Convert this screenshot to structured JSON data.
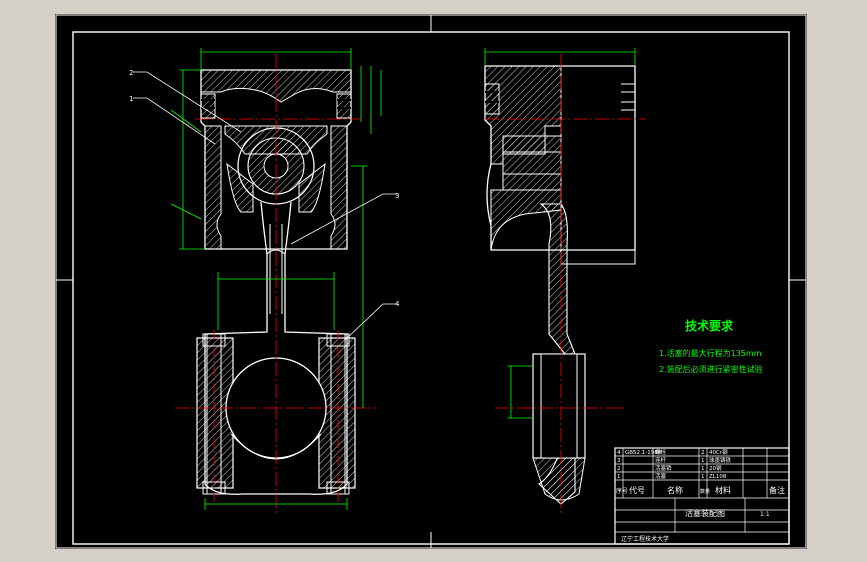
{
  "colors": {
    "background": "#d4d0c8",
    "sheet": "#000000",
    "frame": "#ffffff",
    "dimension": "#00ff00",
    "centerline": "#ff0000",
    "hatch": "#ffffff",
    "note_text": "#00ff00"
  },
  "tech_requirements": {
    "title": "技术要求",
    "items": [
      "1.活塞的最大行程为135mm",
      "2.装配后必须进行紧密性试验"
    ]
  },
  "balloons": [
    "2",
    "1",
    "3",
    "4"
  ],
  "title_block": {
    "parts": [
      {
        "no": "4",
        "code": "GB52.1-1988",
        "name": "螺栓",
        "qty": "2",
        "material": "40Cr钢"
      },
      {
        "no": "3",
        "code": "",
        "name": "连杆",
        "qty": "1",
        "material": "球墨铸铁"
      },
      {
        "no": "2",
        "code": "",
        "name": "活塞销",
        "qty": "1",
        "material": "20钢"
      },
      {
        "no": "1",
        "code": "",
        "name": "活塞",
        "qty": "1",
        "material": "ZL108"
      }
    ],
    "header": {
      "no": "序号",
      "code": "代号",
      "name": "名称",
      "qty": "数量",
      "material": "材料",
      "remark": "备注"
    },
    "drawing_title": "活塞装配图",
    "scale": "1:1",
    "school": "辽宁工程技术大学"
  }
}
